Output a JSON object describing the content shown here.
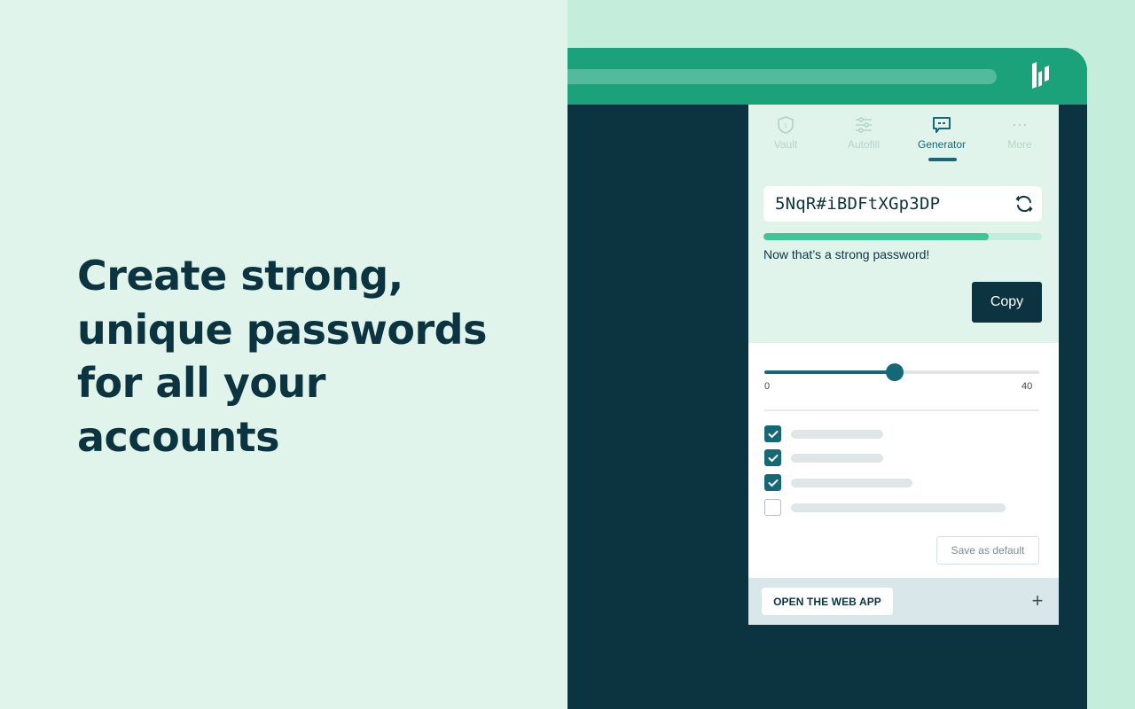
{
  "headline": {
    "line1": "Create strong,",
    "line2": "unique passwords",
    "line3": "for all your",
    "line4": "accounts"
  },
  "browser": {
    "logo_icon": "dashlane-logo-icon"
  },
  "panel": {
    "tabs": [
      {
        "label": "Vault",
        "icon": "shield-icon",
        "active": false
      },
      {
        "label": "Autofill",
        "icon": "sliders-icon",
        "active": false
      },
      {
        "label": "Generator",
        "icon": "chat-bubble-icon",
        "active": true
      },
      {
        "label": "More",
        "icon": "ellipsis-icon",
        "active": false
      }
    ],
    "password": "5NqR#iBDFtXGp3DP",
    "refresh_icon": "refresh-icon",
    "strength_fraction": 0.81,
    "strength_message": "Now that’s a strong password!",
    "copy_label": "Copy",
    "length_slider": {
      "min_label": "0",
      "max_label": "40",
      "min": 0,
      "max": 40,
      "value": 19
    },
    "options": [
      {
        "checked": true
      },
      {
        "checked": true
      },
      {
        "checked": true
      },
      {
        "checked": false
      }
    ],
    "save_default_label": "Save as default",
    "footer": {
      "open_webapp_label": "OPEN THE WEB APP",
      "plus_label": "+"
    }
  },
  "colors": {
    "brand_dark": "#0b3440",
    "brand_green": "#1ba27a",
    "accent_teal": "#166877",
    "strength_green": "#41c497",
    "left_bg": "#e0f4ec",
    "right_bg": "#c4eedb"
  }
}
